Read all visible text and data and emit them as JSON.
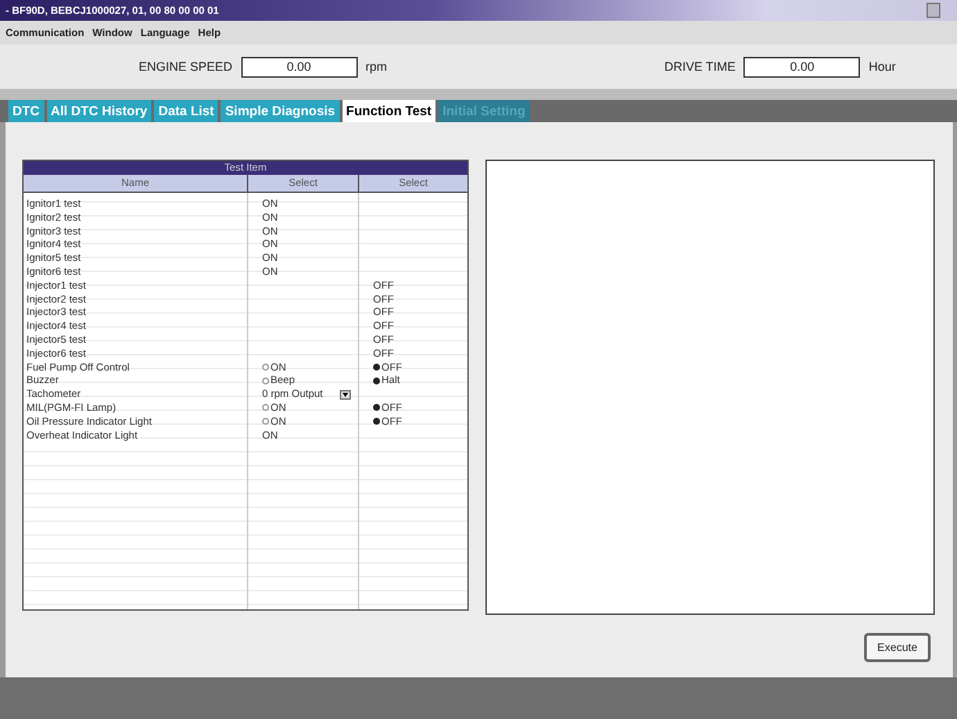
{
  "window": {
    "title": "- BF90D, BEBCJ1000027, 01,  00 80 00 00 01"
  },
  "menu": [
    "Communication",
    "Window",
    "Language",
    "Help"
  ],
  "readouts": [
    {
      "label": "ENGINE SPEED",
      "value": "0.00",
      "unit": "rpm"
    },
    {
      "label": "DRIVE TIME",
      "value": "0.00",
      "unit": "Hour"
    }
  ],
  "tabs": [
    {
      "label": "DTC",
      "selected": false,
      "disabled": false
    },
    {
      "label": "All DTC History",
      "selected": false,
      "disabled": false
    },
    {
      "label": "Data List",
      "selected": false,
      "disabled": false
    },
    {
      "label": "Simple Diagnosis",
      "selected": false,
      "disabled": false
    },
    {
      "label": "Function Test",
      "selected": true,
      "disabled": false
    },
    {
      "label": "Initial Setting",
      "selected": false,
      "disabled": true
    }
  ],
  "table": {
    "title": "Test Item",
    "columns": [
      "Name",
      "Select",
      "Select"
    ],
    "rows": [
      {
        "kind": "text",
        "name": "Ignitor1 test",
        "col_2": "ON"
      },
      {
        "kind": "text",
        "name": "Ignitor2 test",
        "col_2": "ON"
      },
      {
        "kind": "text",
        "name": "Ignitor3 test",
        "col_2": "ON"
      },
      {
        "kind": "text",
        "name": "Ignitor4 test",
        "col_2": "ON"
      },
      {
        "kind": "text",
        "name": "Ignitor5 test",
        "col_2": "ON"
      },
      {
        "kind": "text",
        "name": "Ignitor6 test",
        "col_2": "ON"
      },
      {
        "kind": "text",
        "name": "Injector1 test",
        "col_3": "OFF"
      },
      {
        "kind": "text",
        "name": "Injector2 test",
        "col_3": "OFF"
      },
      {
        "kind": "text",
        "name": "Injector3 test",
        "col_3": "OFF"
      },
      {
        "kind": "text",
        "name": "Injector4 test",
        "col_3": "OFF"
      },
      {
        "kind": "text",
        "name": "Injector5 test",
        "col_3": "OFF"
      },
      {
        "kind": "text",
        "name": "Injector6 test",
        "col_3": "OFF"
      },
      {
        "kind": "radio",
        "name": "Fuel Pump Off Control",
        "options": [
          {
            "label": "ON",
            "selected": false
          },
          {
            "label": "OFF",
            "selected": true
          }
        ]
      },
      {
        "kind": "radio",
        "name": "Buzzer",
        "options": [
          {
            "label": "Beep",
            "selected": false
          },
          {
            "label": "Halt",
            "selected": true
          }
        ]
      },
      {
        "kind": "dropdown",
        "name": "Tachometer",
        "value": "0 rpm Output"
      },
      {
        "kind": "radio",
        "name": "MIL(PGM-FI Lamp)",
        "options": [
          {
            "label": "ON",
            "selected": false
          },
          {
            "label": "OFF",
            "selected": true
          }
        ]
      },
      {
        "kind": "radio",
        "name": "Oil Pressure Indicator Light",
        "options": [
          {
            "label": "ON",
            "selected": false
          },
          {
            "label": "OFF",
            "selected": true
          }
        ]
      },
      {
        "kind": "text",
        "name": "Overheat Indicator Light",
        "col_2": "ON"
      }
    ]
  },
  "buttons": [
    "Execute"
  ]
}
